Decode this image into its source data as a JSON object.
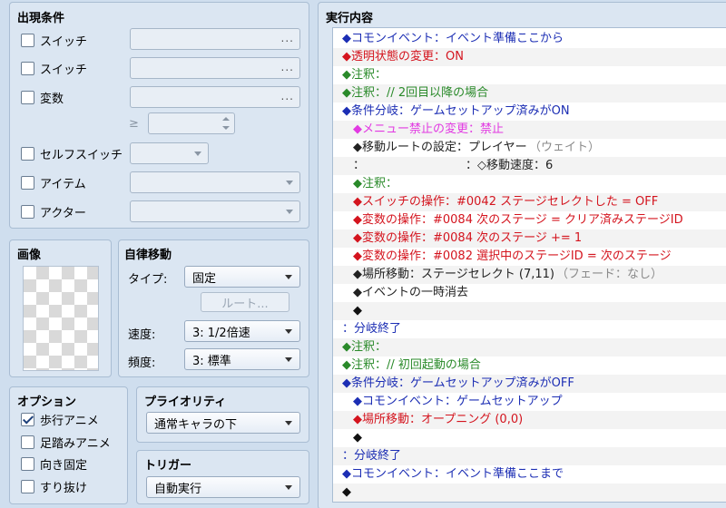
{
  "conditions": {
    "title": "出現条件",
    "switch1": {
      "label": "スイッチ",
      "checked": false,
      "value": "",
      "dots": "..."
    },
    "switch2": {
      "label": "スイッチ",
      "checked": false,
      "value": "",
      "dots": "..."
    },
    "variable": {
      "label": "変数",
      "checked": false,
      "value": "",
      "dots": "...",
      "operator": "≥",
      "number": ""
    },
    "self_switch": {
      "label": "セルフスイッチ",
      "checked": false,
      "value": ""
    },
    "item": {
      "label": "アイテム",
      "checked": false,
      "value": ""
    },
    "actor": {
      "label": "アクター",
      "checked": false,
      "value": ""
    }
  },
  "image": {
    "title": "画像"
  },
  "autonomous": {
    "title": "自律移動",
    "type_label": "タイプ:",
    "type_value": "固定",
    "route_button": "ルート...",
    "speed_label": "速度:",
    "speed_value": "3: 1/2倍速",
    "freq_label": "頻度:",
    "freq_value": "3: 標準"
  },
  "options": {
    "title": "オプション",
    "walking": {
      "label": "歩行アニメ",
      "checked": true
    },
    "stepping": {
      "label": "足踏みアニメ",
      "checked": false
    },
    "direction_fix": {
      "label": "向き固定",
      "checked": false
    },
    "through": {
      "label": "すり抜け",
      "checked": false
    }
  },
  "priority": {
    "title": "プライオリティ",
    "value": "通常キャラの下"
  },
  "trigger": {
    "title": "トリガー",
    "value": "自動実行"
  },
  "exec": {
    "title": "実行内容",
    "commands": [
      {
        "indent": 0,
        "color": "blue",
        "text": "◆コモンイベント：イベント準備ここから"
      },
      {
        "indent": 0,
        "color": "red",
        "text": "◆透明状態の変更：ON"
      },
      {
        "indent": 0,
        "color": "green",
        "text": "◆注釈："
      },
      {
        "indent": 0,
        "color": "green",
        "text": "◆注釈：// 2回目以降の場合"
      },
      {
        "indent": 0,
        "color": "blue",
        "text": "◆条件分岐：ゲームセットアップ済みがON"
      },
      {
        "indent": 1,
        "color": "mag",
        "text": "◆メニュー禁止の変更：禁止"
      },
      {
        "indent": 1,
        "color": "dark",
        "text": "◆移動ルートの設定：プレイヤー",
        "suffix": "（ウェイト）"
      },
      {
        "indent": 1,
        "color": "dark",
        "text": "：",
        "tail": "：◇移動速度：6"
      },
      {
        "indent": 1,
        "color": "green",
        "text": "◆注釈："
      },
      {
        "indent": 1,
        "color": "red",
        "text": "◆スイッチの操作：#0042 ステージセレクトした = OFF"
      },
      {
        "indent": 1,
        "color": "red",
        "text": "◆変数の操作：#0084 次のステージ = クリア済みステージID"
      },
      {
        "indent": 1,
        "color": "red",
        "text": "◆変数の操作：#0084 次のステージ += 1"
      },
      {
        "indent": 1,
        "color": "red",
        "text": "◆変数の操作：#0082 選択中のステージID = 次のステージ"
      },
      {
        "indent": 1,
        "color": "dark",
        "text": "◆場所移動：ステージセレクト (7,11)",
        "suffix": "（フェード：なし）"
      },
      {
        "indent": 1,
        "color": "dark",
        "text": "◆イベントの一時消去"
      },
      {
        "indent": 1,
        "color": "black",
        "text": "◆"
      },
      {
        "indent": 0,
        "color": "blue",
        "text": "：分岐終了"
      },
      {
        "indent": 0,
        "color": "green",
        "text": "◆注釈："
      },
      {
        "indent": 0,
        "color": "green",
        "text": "◆注釈：// 初回起動の場合"
      },
      {
        "indent": 0,
        "color": "blue",
        "text": "◆条件分岐：ゲームセットアップ済みがOFF"
      },
      {
        "indent": 1,
        "color": "blue",
        "text": "◆コモンイベント：ゲームセットアップ"
      },
      {
        "indent": 1,
        "color": "red",
        "text": "◆場所移動：オープニング (0,0)"
      },
      {
        "indent": 1,
        "color": "black",
        "text": "◆"
      },
      {
        "indent": 0,
        "color": "blue",
        "text": "：分岐終了"
      },
      {
        "indent": 0,
        "color": "blue",
        "text": "◆コモンイベント：イベント準備ここまで"
      },
      {
        "indent": 0,
        "color": "black",
        "text": "◆"
      }
    ]
  }
}
